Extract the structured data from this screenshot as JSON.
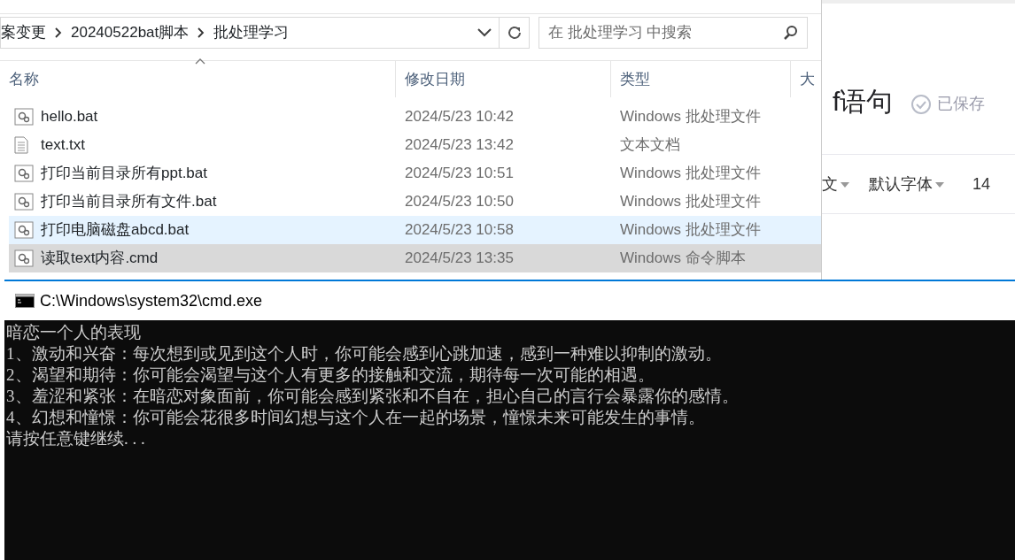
{
  "explorer": {
    "breadcrumb": [
      "案变更",
      "20240522bat脚本",
      "批处理学习"
    ],
    "search": {
      "placeholder": "在 批处理学习 中搜索"
    },
    "columns": [
      "名称",
      "修改日期",
      "类型",
      "大"
    ],
    "files": [
      {
        "name": "hello.bat",
        "date": "2024/5/23 10:42",
        "type": "Windows 批处理文件",
        "kind": "script",
        "hovered": false,
        "selected": false
      },
      {
        "name": "text.txt",
        "date": "2024/5/23 13:42",
        "type": "文本文档",
        "kind": "text",
        "hovered": false,
        "selected": false
      },
      {
        "name": "打印当前目录所有ppt.bat",
        "date": "2024/5/23 10:51",
        "type": "Windows 批处理文件",
        "kind": "script",
        "hovered": false,
        "selected": false
      },
      {
        "name": "打印当前目录所有文件.bat",
        "date": "2024/5/23 10:50",
        "type": "Windows 批处理文件",
        "kind": "script",
        "hovered": false,
        "selected": false
      },
      {
        "name": "打印电脑磁盘abcd.bat",
        "date": "2024/5/23 10:58",
        "type": "Windows 批处理文件",
        "kind": "script",
        "hovered": true,
        "selected": false
      },
      {
        "name": "读取text内容.cmd",
        "date": "2024/5/23 13:35",
        "type": "Windows 命令脚本",
        "kind": "script",
        "hovered": false,
        "selected": true
      }
    ]
  },
  "editor": {
    "title": "f语句",
    "save_status": "已保存",
    "toolbar": [
      "文",
      "默认字体",
      "14"
    ]
  },
  "console": {
    "title": "C:\\Windows\\system32\\cmd.exe",
    "lines": [
      "暗恋一个人的表现",
      "1、激动和兴奋：每次想到或见到这个人时，你可能会感到心跳加速，感到一种难以抑制的激动。",
      "2、渴望和期待：你可能会渴望与这个人有更多的接触和交流，期待每一次可能的相遇。",
      "3、羞涩和紧张：在暗恋对象面前，你可能会感到紧张和不自在，担心自己的言行会暴露你的感情。",
      "4、幻想和憧憬：你可能会花很多时间幻想与这个人在一起的场景，憧憬未来可能发生的事情。",
      "请按任意键继续. . ."
    ]
  }
}
